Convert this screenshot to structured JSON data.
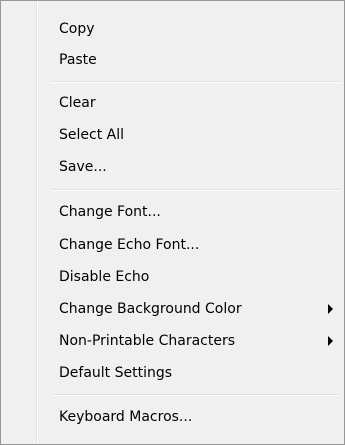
{
  "context_menu": {
    "groups": [
      {
        "items": [
          {
            "label": "Copy",
            "submenu": false
          },
          {
            "label": "Paste",
            "submenu": false
          }
        ]
      },
      {
        "items": [
          {
            "label": "Clear",
            "submenu": false
          },
          {
            "label": "Select All",
            "submenu": false
          },
          {
            "label": "Save...",
            "submenu": false
          }
        ]
      },
      {
        "items": [
          {
            "label": "Change Font...",
            "submenu": false
          },
          {
            "label": "Change Echo Font...",
            "submenu": false
          },
          {
            "label": "Disable Echo",
            "submenu": false
          },
          {
            "label": "Change Background Color",
            "submenu": true
          },
          {
            "label": "Non-Printable Characters",
            "submenu": true
          },
          {
            "label": "Default Settings",
            "submenu": false
          }
        ]
      },
      {
        "items": [
          {
            "label": "Keyboard Macros...",
            "submenu": false
          }
        ]
      }
    ]
  }
}
